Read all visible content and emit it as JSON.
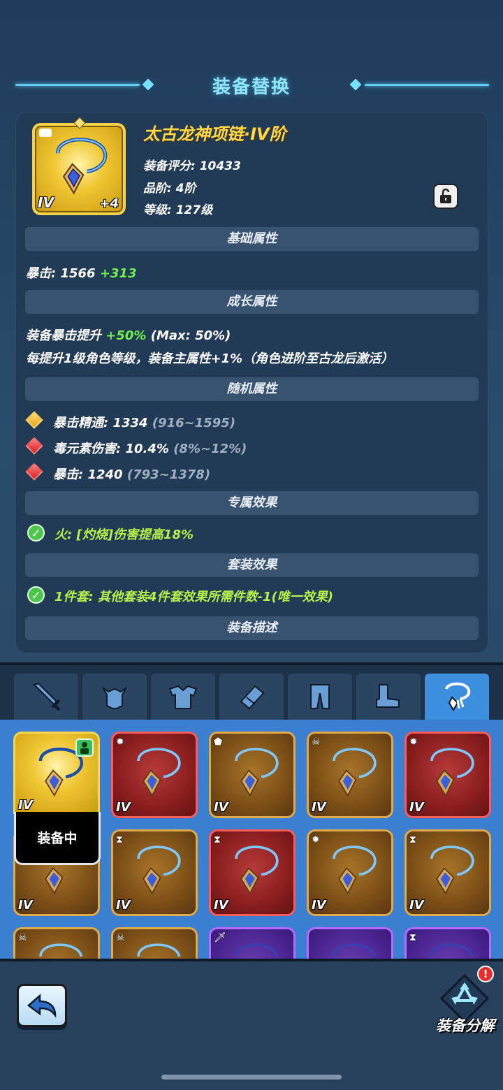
{
  "header": {
    "title": "装备替换"
  },
  "item": {
    "name": "太古龙神项链·IV阶",
    "tier_numeral": "IV",
    "enhance": "+4",
    "score": "装备评分: 10433",
    "grade": "品阶: 4阶",
    "level": "等级: 127级"
  },
  "sections": {
    "basic": "基础属性",
    "growth": "成长属性",
    "random": "随机属性",
    "exclusive": "专属效果",
    "set": "套装效果",
    "description": "装备描述"
  },
  "basic_stat": {
    "label": "暴击: 1566",
    "bonus": "+313"
  },
  "growth_stats": {
    "line1_label": "装备暴击提升",
    "line1_value": "+50%",
    "line1_max": "(Max: 50%)",
    "line2": "每提升1级角色等级，装备主属性+1%（角色进阶至古龙后激活）"
  },
  "random_stats": [
    {
      "label": "暴击精通: 1334",
      "range": "(916~1595)",
      "gem": "gold"
    },
    {
      "label": "毒元素伤害: 10.4%",
      "range": "(8%~12%)",
      "gem": "red"
    },
    {
      "label": "暴击: 1240",
      "range": "(793~1378)",
      "gem": "red"
    }
  ],
  "exclusive_effect": "火: [灼烧]伤害提高18%",
  "set_effect": "1件套: 其他套装4件套效果所需件数-1(唯一效果)",
  "tabs": [
    "sword-icon",
    "helmet-icon",
    "armor-icon",
    "bracer-icon",
    "pants-icon",
    "boots-icon",
    "necklace-icon"
  ],
  "inventory": {
    "equipped_label": "装备中",
    "cell_numeral": "IV"
  },
  "bottom": {
    "dismantle_label": "装备分解",
    "notify_mark": "!"
  }
}
